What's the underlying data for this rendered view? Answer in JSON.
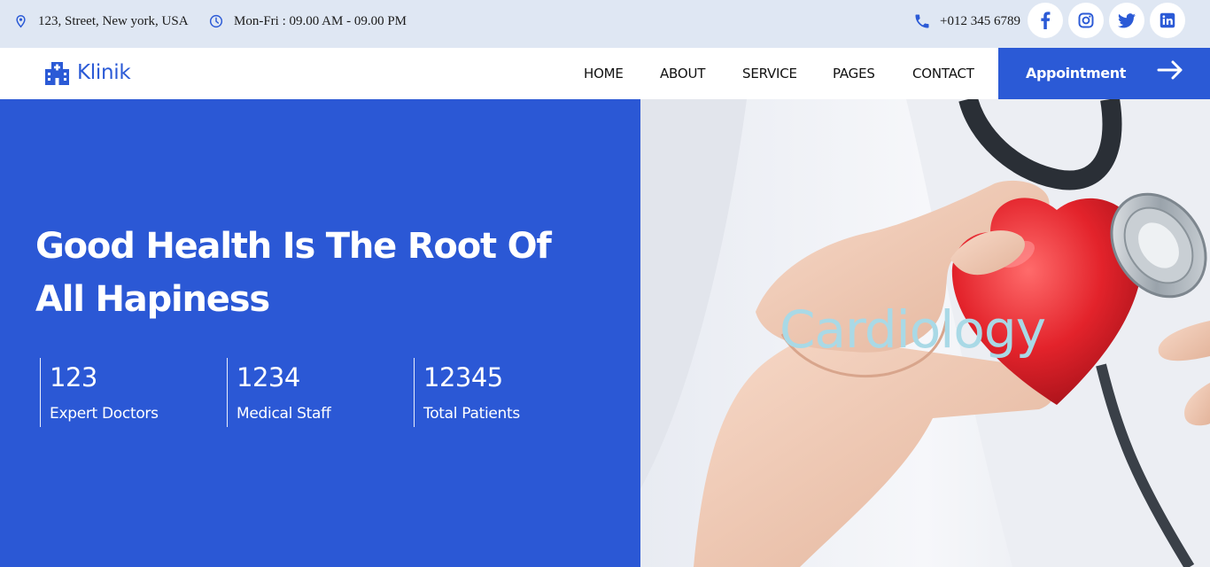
{
  "topbar": {
    "address": "123, Street, New york, USA",
    "hours": "Mon-Fri : 09.00 AM - 09.00 PM",
    "phone": "+012 345 6789",
    "social": [
      {
        "name": "facebook-icon"
      },
      {
        "name": "instagram-icon"
      },
      {
        "name": "twitter-icon"
      },
      {
        "name": "linkedin-icon"
      }
    ]
  },
  "nav": {
    "brand": "Klinik",
    "links": [
      "HOME",
      "ABOUT",
      "SERVICE",
      "PAGES",
      "CONTACT"
    ],
    "appointment_label": "Appointment"
  },
  "hero": {
    "title": "Good Health Is The Root Of All Hapiness",
    "stats": [
      {
        "value": "123",
        "label": "Expert Doctors"
      },
      {
        "value": "1234",
        "label": "Medical Staff"
      },
      {
        "value": "12345",
        "label": "Total Patients"
      }
    ],
    "image_caption": "Cardiology"
  },
  "colors": {
    "primary": "#2b5ad6",
    "topbar_bg": "#dfe7f3",
    "caption": "#a9d9e6"
  }
}
